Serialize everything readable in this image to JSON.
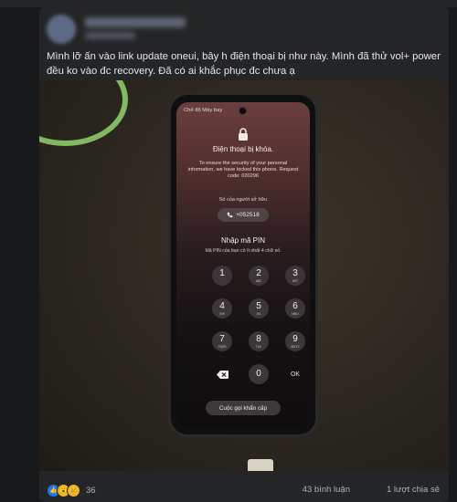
{
  "post": {
    "text": "Mình lỡ ấn vào link update oneui, bây h điện thoại bị như này. Mình đã thử vol+ power đều ko vào đc recovery. Đã có ai khắc phục đc chưa ạ"
  },
  "phone_screen": {
    "status": "Chế độ Máy bay",
    "title": "Điện thoại bị khóa.",
    "description": "To ensure the security of your personal information, we have locked this phone. Request code: 020296",
    "owner_label": "Số của người sở hữu",
    "owner_number": "+052518",
    "pin_title": "Nhập mã PIN",
    "pin_hint": "Mã PIN của bạn có ít nhất 4 chữ số.",
    "keys": [
      {
        "num": "1",
        "letters": ""
      },
      {
        "num": "2",
        "letters": "ABC"
      },
      {
        "num": "3",
        "letters": "DEF"
      },
      {
        "num": "4",
        "letters": "GHI"
      },
      {
        "num": "5",
        "letters": "JKL"
      },
      {
        "num": "6",
        "letters": "MNO"
      },
      {
        "num": "7",
        "letters": "PQRS"
      },
      {
        "num": "8",
        "letters": "TUV"
      },
      {
        "num": "9",
        "letters": "WXYZ"
      },
      {
        "num": "0",
        "letters": ""
      }
    ],
    "ok_label": "OK",
    "emergency_label": "Cuộc gọi khẩn cấp"
  },
  "footer": {
    "reaction_count": "36",
    "comments": "43 bình luận",
    "shares": "1 lượt chia sẻ",
    "reactions": [
      "like-icon",
      "wow-icon",
      "sad-icon"
    ]
  }
}
